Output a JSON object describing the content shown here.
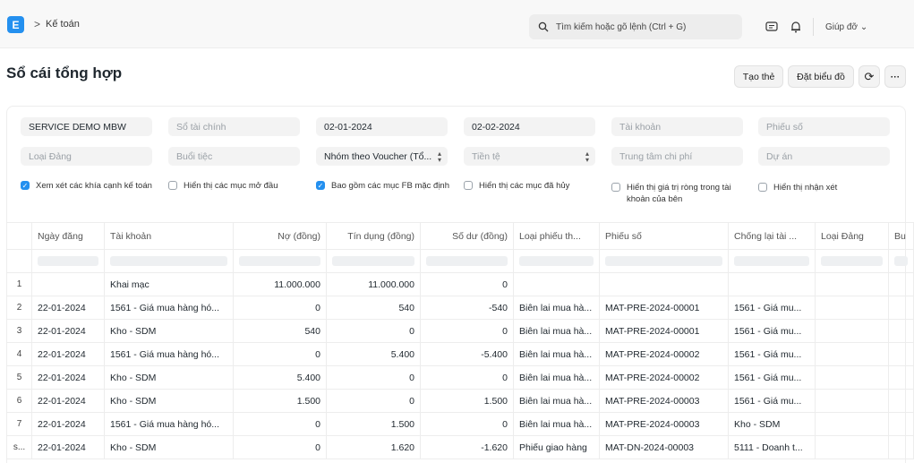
{
  "navbar": {
    "logo": "E",
    "breadcrumb_sep": ">",
    "breadcrumb": "Kế toán",
    "search_placeholder": "Tìm kiếm hoặc gõ lệnh (Ctrl + G)",
    "help_label": "Giúp đỡ"
  },
  "page": {
    "title": "Sổ cái tổng hợp",
    "buttons": {
      "create_card": "Tạo thẻ",
      "set_chart": "Đặt biểu đồ",
      "refresh": "⟳",
      "more": "···"
    }
  },
  "filters": {
    "company": "SERVICE DEMO MBW",
    "finance_book": "Sổ tài chính",
    "from_date": "02-01-2024",
    "to_date": "02-02-2024",
    "account": "Tài khoản",
    "voucher_no": "Phiếu số",
    "party_type": "Loại Đảng",
    "party": "Buổi tiệc",
    "group_by": "Nhóm theo Voucher (Tổ...",
    "currency": "Tiền tệ",
    "cost_center": "Trung tâm chi phí",
    "project": "Dự án",
    "checks": [
      {
        "label": "Xem xét các khía cạnh kế toán",
        "checked": true
      },
      {
        "label": "Hiển thị các mục mở đầu",
        "checked": false
      },
      {
        "label": "Bao gồm các mục FB mặc định",
        "checked": true
      },
      {
        "label": "Hiển thị các mục đã hủy",
        "checked": false
      },
      {
        "label": "Hiển thị giá trị ròng trong tài khoản của bên",
        "checked": false
      },
      {
        "label": "Hiển thị nhận xét",
        "checked": false
      }
    ]
  },
  "table": {
    "columns": [
      "Ngày đăng",
      "Tài khoản",
      "Nợ (đồng)",
      "Tín dụng (đồng)",
      "Số dư (đồng)",
      "Loại phiếu th...",
      "Phiếu số",
      "Chống lại tài ...",
      "Loại Đảng",
      "Bu"
    ],
    "rows": [
      {
        "idx": "1",
        "date": "",
        "account": "Khai mạc",
        "debit": "11.000.000",
        "credit": "11.000.000",
        "balance": "0",
        "vtype": "",
        "vno": "",
        "against": "",
        "ptype": ""
      },
      {
        "idx": "2",
        "date": "22-01-2024",
        "account": "1561 - Giá mua hàng hó...",
        "debit": "0",
        "credit": "540",
        "balance": "-540",
        "vtype": "Biên lai mua hà...",
        "vno": "MAT-PRE-2024-00001",
        "against": "1561 - Giá mu...",
        "ptype": ""
      },
      {
        "idx": "3",
        "date": "22-01-2024",
        "account": "Kho - SDM",
        "debit": "540",
        "credit": "0",
        "balance": "0",
        "vtype": "Biên lai mua hà...",
        "vno": "MAT-PRE-2024-00001",
        "against": "1561 - Giá mu...",
        "ptype": ""
      },
      {
        "idx": "4",
        "date": "22-01-2024",
        "account": "1561 - Giá mua hàng hó...",
        "debit": "0",
        "credit": "5.400",
        "balance": "-5.400",
        "vtype": "Biên lai mua hà...",
        "vno": "MAT-PRE-2024-00002",
        "against": "1561 - Giá mu...",
        "ptype": ""
      },
      {
        "idx": "5",
        "date": "22-01-2024",
        "account": "Kho - SDM",
        "debit": "5.400",
        "credit": "0",
        "balance": "0",
        "vtype": "Biên lai mua hà...",
        "vno": "MAT-PRE-2024-00002",
        "against": "1561 - Giá mu...",
        "ptype": ""
      },
      {
        "idx": "6",
        "date": "22-01-2024",
        "account": "Kho - SDM",
        "debit": "1.500",
        "credit": "0",
        "balance": "1.500",
        "vtype": "Biên lai mua hà...",
        "vno": "MAT-PRE-2024-00003",
        "against": "1561 - Giá mu...",
        "ptype": ""
      },
      {
        "idx": "7",
        "date": "22-01-2024",
        "account": "1561 - Giá mua hàng hó...",
        "debit": "0",
        "credit": "1.500",
        "balance": "0",
        "vtype": "Biên lai mua hà...",
        "vno": "MAT-PRE-2024-00003",
        "against": "Kho - SDM",
        "ptype": ""
      },
      {
        "idx": "s...",
        "date": "22-01-2024",
        "account": "Kho - SDM",
        "debit": "0",
        "credit": "1.620",
        "balance": "-1.620",
        "vtype": "Phiếu giao hàng",
        "vno": "MAT-DN-2024-00003",
        "against": "5111 - Doanh t...",
        "ptype": ""
      }
    ]
  }
}
